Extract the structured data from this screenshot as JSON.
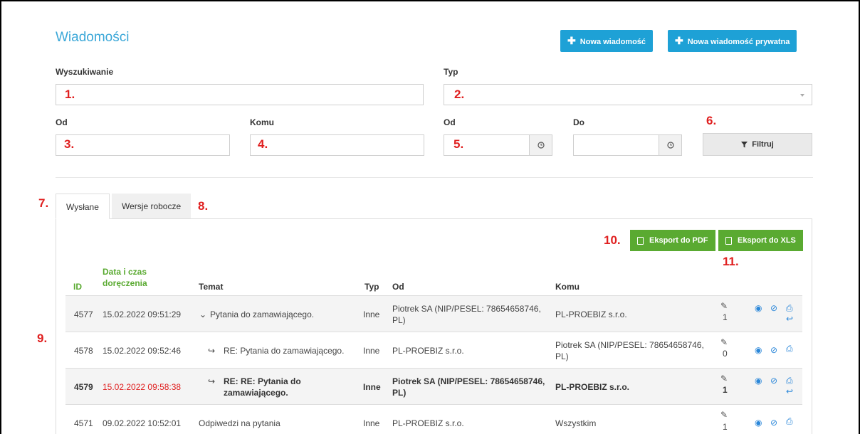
{
  "page": {
    "title": "Wiadomości"
  },
  "header": {
    "new_message": "Nowa wiadomość",
    "new_private_message": "Nowa wiadomość prywatna"
  },
  "filters": {
    "search_label": "Wyszukiwanie",
    "search_marker": "1.",
    "type_label": "Typ",
    "type_marker": "2.",
    "from_label": "Od",
    "from_marker": "3.",
    "to_label": "Komu",
    "to_marker": "4.",
    "date_from_label": "Od",
    "date_from_marker": "5.",
    "date_to_label": "Do",
    "filter_marker": "6.",
    "filter_button": "Filtruj"
  },
  "tabs": {
    "marker_left": "7.",
    "sent": "Wysłane",
    "drafts": "Wersje robocze",
    "marker_right": "8."
  },
  "list_marker": "9.",
  "exports": {
    "pdf_marker": "10.",
    "pdf": "Eksport do PDF",
    "xls": "Eksport do XLS",
    "xls_marker": "11."
  },
  "table": {
    "headers": {
      "id": "ID",
      "date_line1": "Data i czas",
      "date_line2": "doręczenia",
      "subject": "Temat",
      "type": "Typ",
      "from": "Od",
      "to": "Komu"
    },
    "rows": [
      {
        "id": "4577",
        "date": "15.02.2022 09:51:29",
        "subject": "Pytania do zamawiającego.",
        "type": "Inne",
        "from": "Piotrek SA (NIP/PESEL: 78654658746, PL)",
        "to": "PL-PROEBIZ s.r.o.",
        "attachments": "1"
      },
      {
        "id": "4578",
        "date": "15.02.2022 09:52:46",
        "subject": "RE: Pytania do zamawiającego.",
        "type": "Inne",
        "from": "PL-PROEBIZ s.r.o.",
        "to": "Piotrek SA (NIP/PESEL: 78654658746, PL)",
        "attachments": "0"
      },
      {
        "id": "4579",
        "date": "15.02.2022 09:58:38",
        "subject": "RE: RE: Pytania do zamawiającego.",
        "type": "Inne",
        "from": "Piotrek SA (NIP/PESEL: 78654658746, PL)",
        "to": "PL-PROEBIZ s.r.o.",
        "attachments": "1"
      },
      {
        "id": "4571",
        "date": "09.02.2022 10:52:01",
        "subject": "Odpiwedzi na pytania",
        "type": "Inne",
        "from": "PL-PROEBIZ s.r.o.",
        "to": "Wszystkim",
        "attachments": "1"
      }
    ]
  },
  "colors": {
    "accent": "#1ea1d6",
    "green": "#5aaa31",
    "marker": "#e02020",
    "icon": "#2b87d9"
  }
}
